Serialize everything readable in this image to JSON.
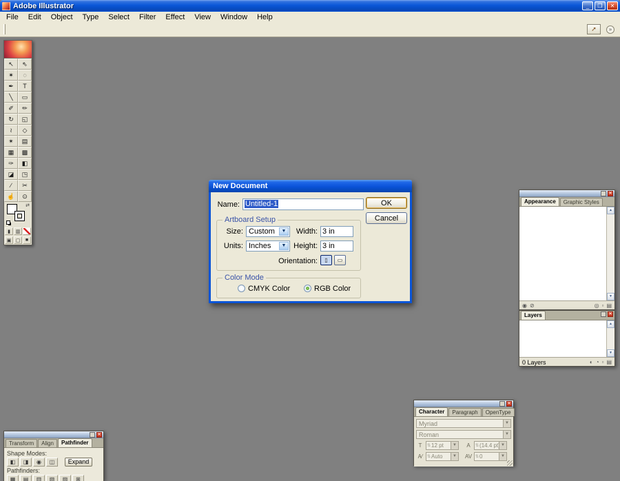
{
  "window": {
    "title": "Adobe Illustrator"
  },
  "icons": {
    "minimize": "_",
    "maximize": "❐",
    "close": "✕",
    "palette_close": "✕",
    "palette_min": "▪",
    "combo_arrow": "▼",
    "spinner": "⇅",
    "bridge": "➚",
    "flyout": "»",
    "swap": "⇄",
    "portrait": "▯",
    "landscape": "▭",
    "scroll_up": "▲",
    "scroll_down": "▼",
    "size_icon": "T",
    "leading_icon": "A",
    "kerning_icon": "A⁄",
    "tracking_icon": "AV"
  },
  "menu_items": [
    "File",
    "Edit",
    "Object",
    "Type",
    "Select",
    "Filter",
    "Effect",
    "View",
    "Window",
    "Help"
  ],
  "toolbox": {
    "tools": [
      {
        "name": "selection-tool",
        "glyph": "↖"
      },
      {
        "name": "direct-selection-tool",
        "glyph": "⇖"
      },
      {
        "name": "magic-wand-tool",
        "glyph": "✶"
      },
      {
        "name": "lasso-tool",
        "glyph": "◌"
      },
      {
        "name": "pen-tool",
        "glyph": "✒"
      },
      {
        "name": "type-tool",
        "glyph": "T"
      },
      {
        "name": "line-segment-tool",
        "glyph": "╲"
      },
      {
        "name": "rectangle-tool",
        "glyph": "▭"
      },
      {
        "name": "paintbrush-tool",
        "glyph": "✐"
      },
      {
        "name": "pencil-tool",
        "glyph": "✏"
      },
      {
        "name": "rotate-tool",
        "glyph": "↻"
      },
      {
        "name": "scale-tool",
        "glyph": "◱"
      },
      {
        "name": "warp-tool",
        "glyph": "≀"
      },
      {
        "name": "free-transform-tool",
        "glyph": "◇"
      },
      {
        "name": "symbol-sprayer-tool",
        "glyph": "✴"
      },
      {
        "name": "column-graph-tool",
        "glyph": "▤"
      },
      {
        "name": "mesh-tool",
        "glyph": "▦"
      },
      {
        "name": "gradient-tool",
        "glyph": "▩"
      },
      {
        "name": "eyedropper-tool",
        "glyph": "✑"
      },
      {
        "name": "blend-tool",
        "glyph": "◧"
      },
      {
        "name": "live-paint-bucket-tool",
        "glyph": "◪"
      },
      {
        "name": "live-paint-selection-tool",
        "glyph": "◳"
      },
      {
        "name": "slice-tool",
        "glyph": "∕"
      },
      {
        "name": "scissors-tool",
        "glyph": "✂"
      },
      {
        "name": "hand-tool",
        "glyph": "☝"
      },
      {
        "name": "zoom-tool",
        "glyph": "⊙"
      }
    ],
    "color_buttons": [
      {
        "name": "color-button",
        "glyph": "▮"
      },
      {
        "name": "gradient-button",
        "glyph": "▥"
      },
      {
        "name": "none-button",
        "glyph": ""
      }
    ],
    "screen_buttons": [
      {
        "name": "standard-screen-mode-button",
        "glyph": "▣"
      },
      {
        "name": "full-screen-with-menu-mode-button",
        "glyph": "▢"
      },
      {
        "name": "full-screen-mode-button",
        "glyph": "■"
      }
    ]
  },
  "dialog": {
    "title": "New Document",
    "name_label": "Name:",
    "name_value": "Untitled-1",
    "ok_label": "OK",
    "cancel_label": "Cancel",
    "artboard_group": "Artboard Setup",
    "size_label": "Size:",
    "size_value": "Custom",
    "width_label": "Width:",
    "width_value": "3 in",
    "units_label": "Units:",
    "units_value": "Inches",
    "height_label": "Height:",
    "height_value": "3 in",
    "orientation_label": "Orientation:",
    "color_group": "Color Mode",
    "cmyk_label": "CMYK Color",
    "rgb_label": "RGB Color"
  },
  "appearance_panel": {
    "tabs": [
      {
        "label": "Appearance",
        "active": true
      },
      {
        "label": "Graphic Styles",
        "active": false
      }
    ],
    "left_icons": [
      {
        "name": "new-art-basic-appearance-button",
        "glyph": "◉"
      },
      {
        "name": "clear-appearance-button",
        "glyph": "⊘"
      }
    ],
    "right_icons": [
      {
        "name": "reduce-to-basic-appearance-button",
        "glyph": "◎"
      },
      {
        "name": "duplicate-item-button",
        "glyph": "▫"
      },
      {
        "name": "delete-item-button",
        "glyph": "▤"
      }
    ]
  },
  "layers_panel": {
    "tab": "Layers",
    "status": "0 Layers",
    "bottom_icons": [
      {
        "name": "make-clipping-mask-button",
        "glyph": "◐"
      },
      {
        "name": "new-sublayer-button",
        "glyph": "◔"
      },
      {
        "name": "new-layer-button",
        "glyph": "▫"
      },
      {
        "name": "delete-layer-button",
        "glyph": "▤"
      }
    ]
  },
  "character_panel": {
    "tabs": [
      {
        "label": "Character",
        "active": true
      },
      {
        "label": "Paragraph",
        "active": false
      },
      {
        "label": "OpenType",
        "active": false
      }
    ],
    "font_value": "Myriad",
    "style_value": "Roman",
    "size_value": "12 pt",
    "leading_value": "(14.4 pt)",
    "kerning_value": "Auto",
    "tracking_value": "0"
  },
  "pathfinder_panel": {
    "tabs": [
      {
        "label": "Transform",
        "active": false
      },
      {
        "label": "Align",
        "active": false
      },
      {
        "label": "Pathfinder",
        "active": true
      }
    ],
    "shape_modes_label": "Shape Modes:",
    "expand_label": "Expand",
    "pathfinders_label": "Pathfinders:",
    "shape_mode_buttons": [
      {
        "name": "add-to-shape-area-button",
        "glyph": "◧"
      },
      {
        "name": "subtract-from-shape-area-button",
        "glyph": "◨"
      },
      {
        "name": "intersect-shape-areas-button",
        "glyph": "◉"
      },
      {
        "name": "exclude-shape-areas-button",
        "glyph": "◫"
      }
    ],
    "pathfinder_buttons": [
      {
        "name": "divide-button",
        "glyph": "▦"
      },
      {
        "name": "trim-button",
        "glyph": "▤"
      },
      {
        "name": "merge-button",
        "glyph": "▥"
      },
      {
        "name": "crop-button",
        "glyph": "▧"
      },
      {
        "name": "outline-button",
        "glyph": "▨"
      },
      {
        "name": "minus-back-button",
        "glyph": "⊞"
      }
    ]
  }
}
